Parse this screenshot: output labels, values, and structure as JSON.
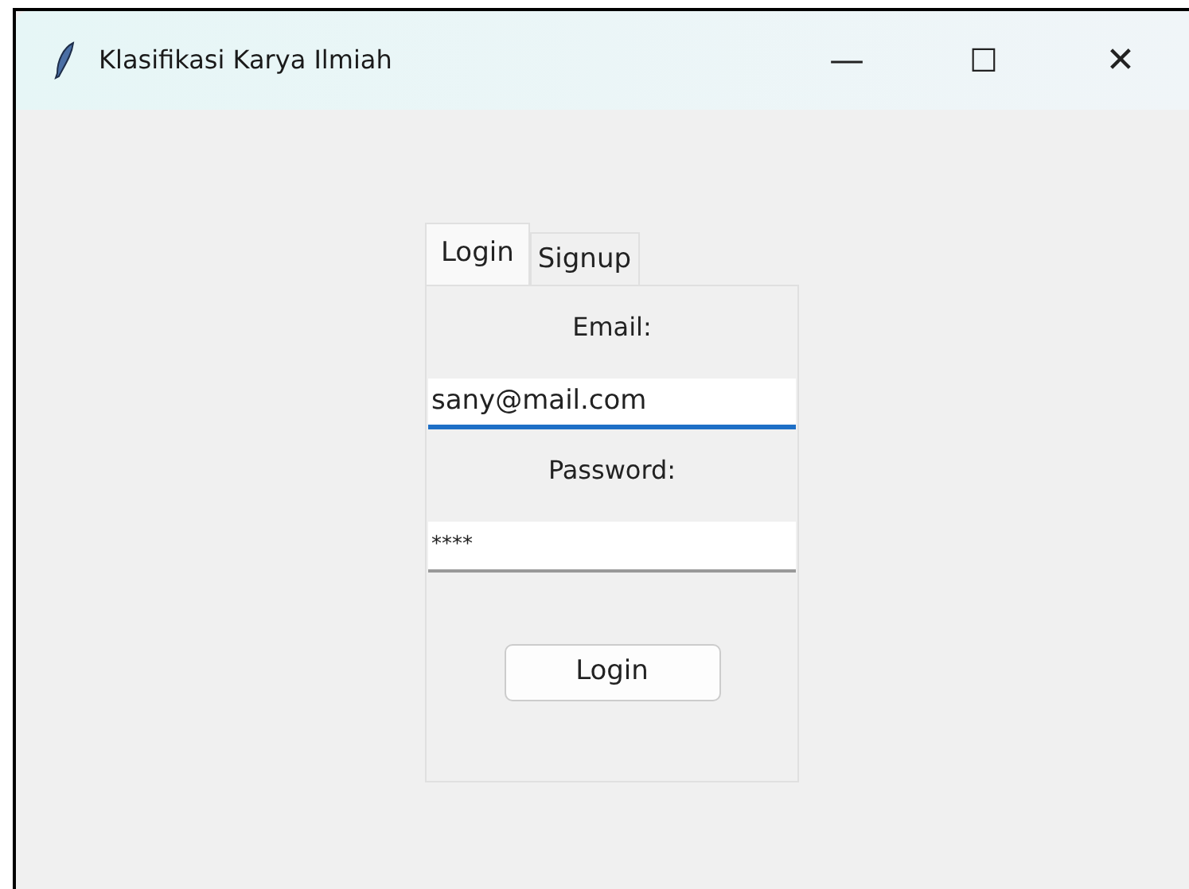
{
  "window": {
    "title": "Klasifikasi Karya Ilmiah",
    "controls": [
      "—",
      "☐",
      "✕"
    ]
  },
  "tabs": [
    {
      "label": "Login",
      "selected": true
    },
    {
      "label": "Signup",
      "selected": false
    }
  ],
  "form": {
    "fields": [
      {
        "label": "Email:",
        "value": "sany@mail.com",
        "focused": true
      },
      {
        "label": "Password:",
        "value": "****",
        "focused": false
      }
    ],
    "button": "Login"
  }
}
